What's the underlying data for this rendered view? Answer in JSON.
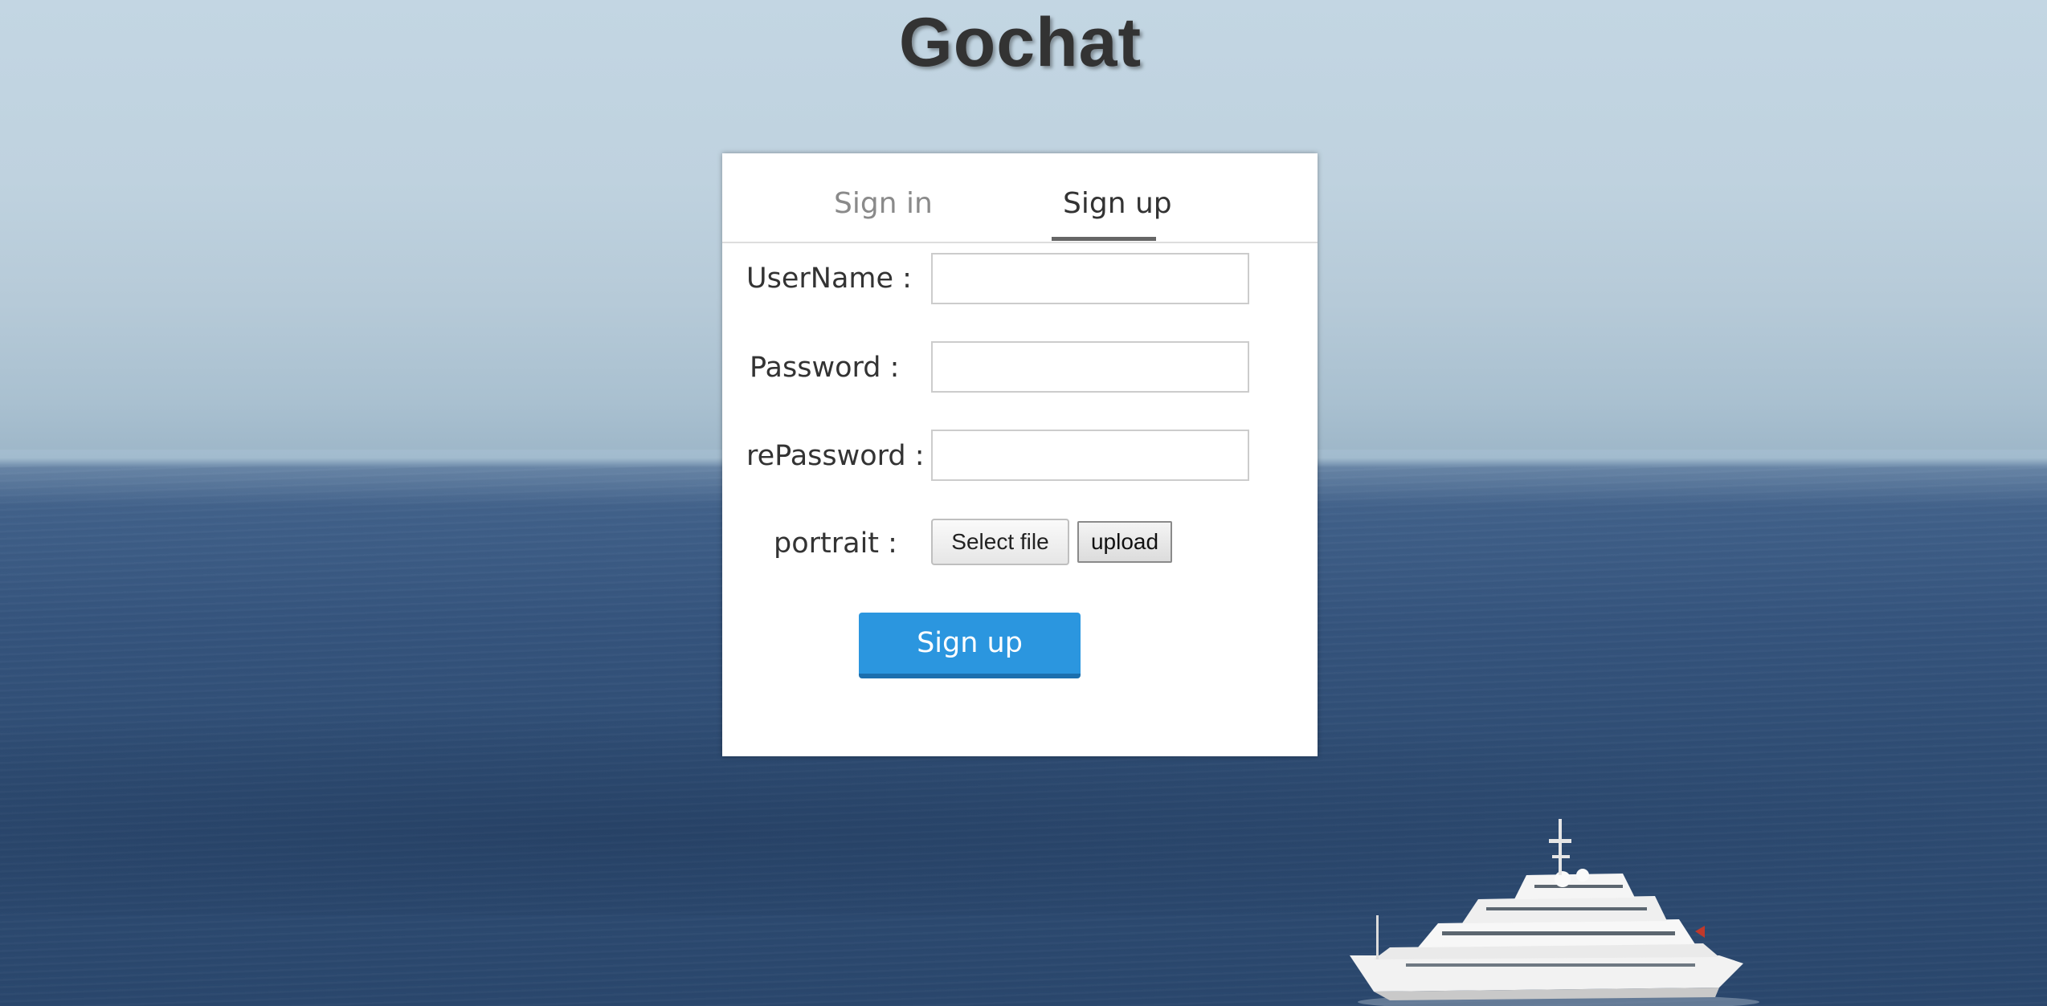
{
  "app": {
    "title": "Gochat"
  },
  "tabs": {
    "sign_in": "Sign in",
    "sign_up": "Sign up",
    "active": "sign_up"
  },
  "form": {
    "username_label": "UserName :",
    "username_value": "",
    "password_label": "Password :",
    "password_value": "",
    "repassword_label": "rePassword :",
    "repassword_value": "",
    "portrait_label": "portrait :",
    "select_file_label": "Select file",
    "upload_label": "upload",
    "submit_label": "Sign up"
  },
  "colors": {
    "primary_button": "#2b96df",
    "title_text": "#333333",
    "inactive_tab": "#8a8a8a"
  }
}
